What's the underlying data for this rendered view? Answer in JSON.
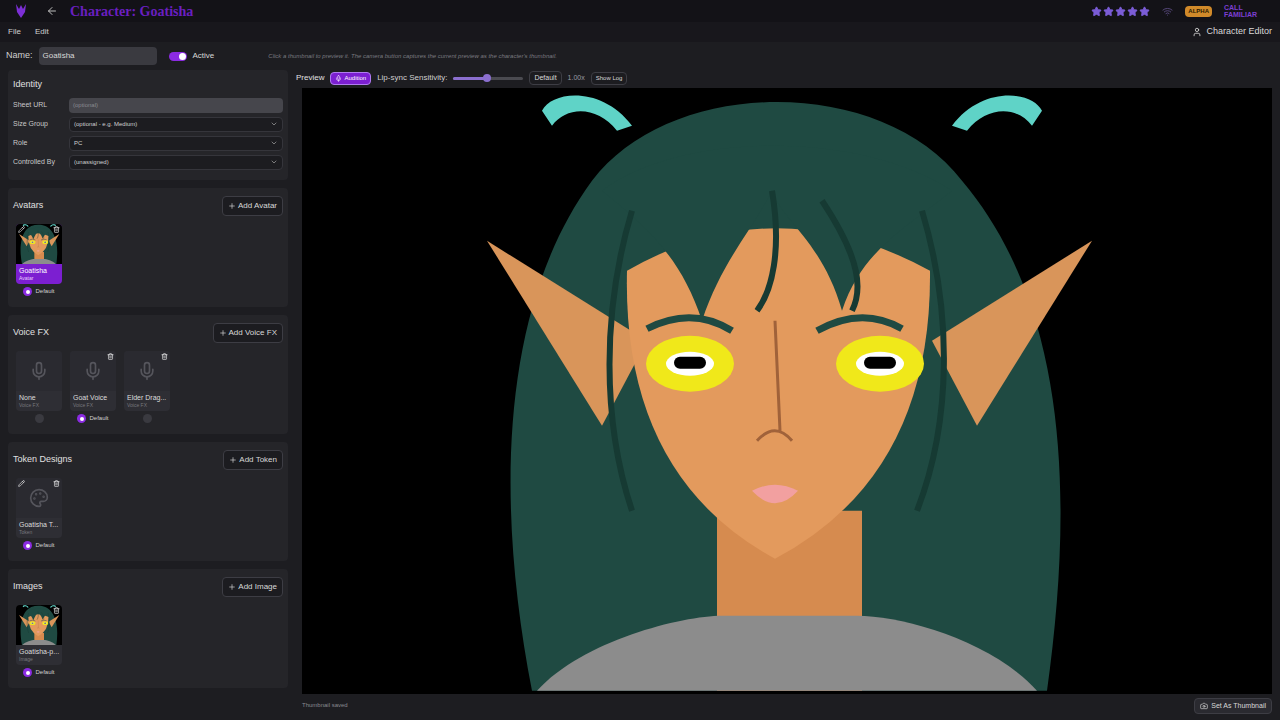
{
  "header": {
    "title": "Character: Goatisha",
    "stars": 5,
    "badge": "ALPHA",
    "brand": "CALL FAMILIAR"
  },
  "menu": [
    "File",
    "Edit"
  ],
  "mode": "Character Editor",
  "name_row": {
    "label": "Name:",
    "value": "Goatisha",
    "active": true,
    "active_label": "Active",
    "hint": "Click a thumbnail to preview it. The camera button captures the current preview as the character's thumbnail."
  },
  "identity": {
    "title": "Identity",
    "fields": [
      {
        "label": "Sheet URL",
        "value": "",
        "placeholder": "(optional)",
        "kind": "text"
      },
      {
        "label": "Size Group",
        "value": "(optional - e.g. Medium)",
        "placeholder": "",
        "kind": "select"
      },
      {
        "label": "Role",
        "value": "PC",
        "placeholder": "",
        "kind": "select"
      },
      {
        "label": "Controlled By",
        "value": "(unassigned)",
        "placeholder": "",
        "kind": "select"
      }
    ]
  },
  "sections": [
    {
      "title": "Avatars",
      "add": "Add Avatar",
      "items": [
        {
          "name": "Goatisha",
          "type": "Avatar",
          "kind": "portrait",
          "selected": true,
          "default": true,
          "default_label": "Default",
          "editable": true,
          "deletable": true
        }
      ]
    },
    {
      "title": "Voice FX",
      "add": "Add Voice FX",
      "items": [
        {
          "name": "None",
          "type": "Voice FX",
          "kind": "voice",
          "selected": false,
          "default": false,
          "default_label": "",
          "editable": false,
          "deletable": false
        },
        {
          "name": "Goat Voice",
          "type": "Voice FX",
          "kind": "voice",
          "selected": false,
          "default": true,
          "default_label": "Default",
          "editable": false,
          "deletable": true
        },
        {
          "name": "Elder Drag...",
          "type": "Voice FX",
          "kind": "voice",
          "selected": false,
          "default": false,
          "default_label": "",
          "editable": false,
          "deletable": true
        }
      ]
    },
    {
      "title": "Token Designs",
      "add": "Add Token",
      "items": [
        {
          "name": "Goatisha T...",
          "type": "Token",
          "kind": "token",
          "selected": false,
          "default": true,
          "default_label": "Default",
          "editable": true,
          "deletable": true
        }
      ]
    },
    {
      "title": "Images",
      "add": "Add Image",
      "items": [
        {
          "name": "Goatisha-p...",
          "type": "Image",
          "kind": "portrait",
          "selected": false,
          "default": true,
          "default_label": "Default",
          "editable": false,
          "deletable": true
        }
      ]
    }
  ],
  "preview": {
    "title": "Preview",
    "audition": "Audition",
    "audition_on": true,
    "sensitivity_label": "Lip-sync Sensitivity:",
    "level": 0.48,
    "default": "Default",
    "reading": "1.00x",
    "log": "Show Log"
  },
  "footer": {
    "status": "Thumbnail saved",
    "button": "Set As Thumbnail"
  }
}
